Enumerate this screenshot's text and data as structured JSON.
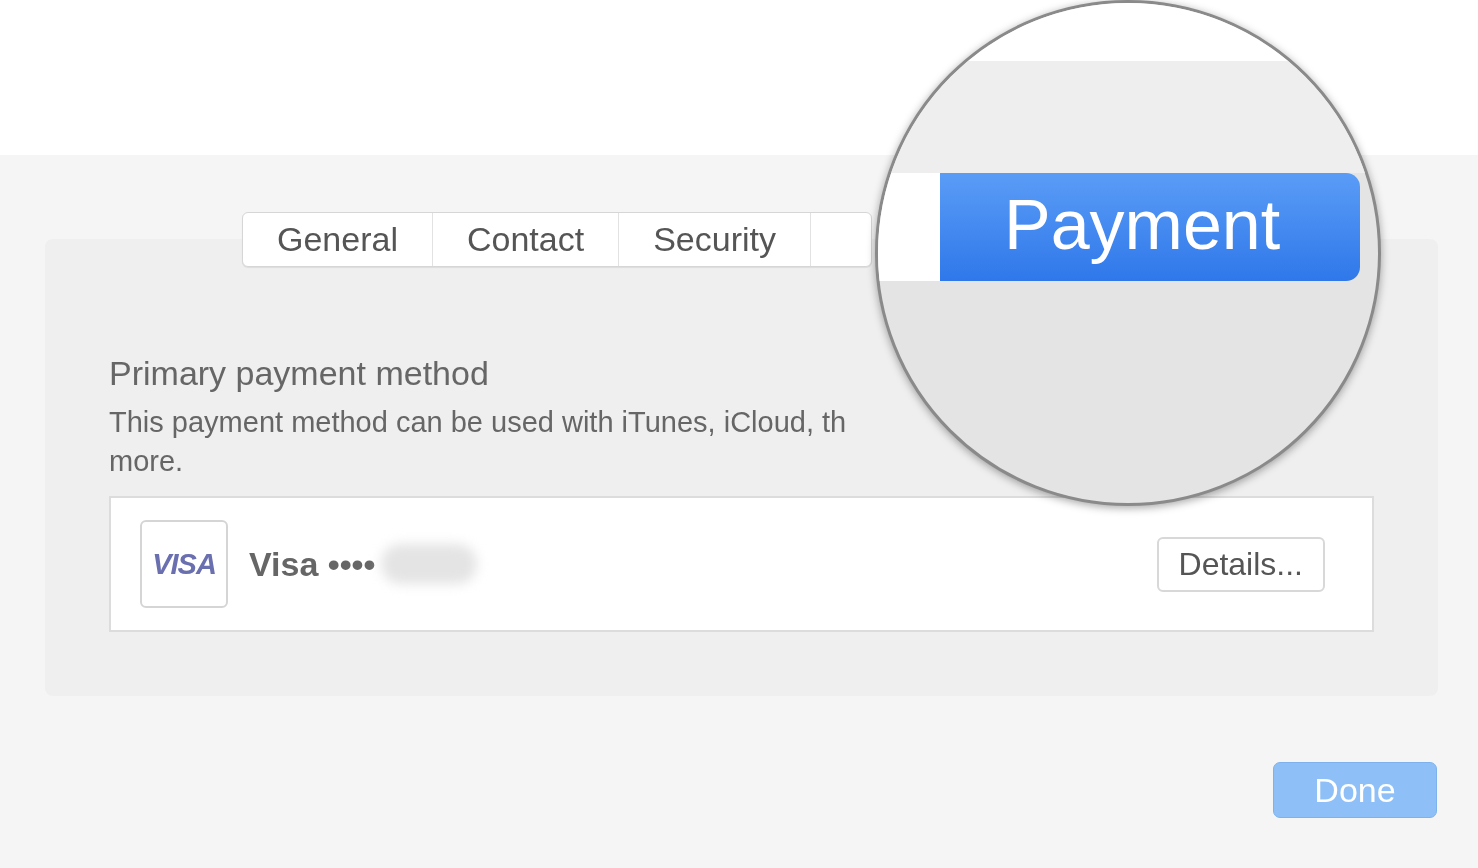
{
  "tabs": [
    {
      "label": "General",
      "selected": false
    },
    {
      "label": "Contact",
      "selected": false
    },
    {
      "label": "Security",
      "selected": false
    }
  ],
  "magnifier": {
    "tabs": [
      {
        "selected": false
      },
      {
        "label": "Payment",
        "selected": true
      }
    ]
  },
  "section": {
    "heading": "Primary payment method",
    "description_lines": [
      [
        "This payment method can be used with iTunes, iCloud, th"
      ],
      [
        "more."
      ]
    ]
  },
  "payment_method": {
    "logo": "VISA",
    "name": "Visa ••••",
    "number_blurred": true,
    "button": "Details..."
  },
  "done_button": {
    "label": "Done"
  }
}
